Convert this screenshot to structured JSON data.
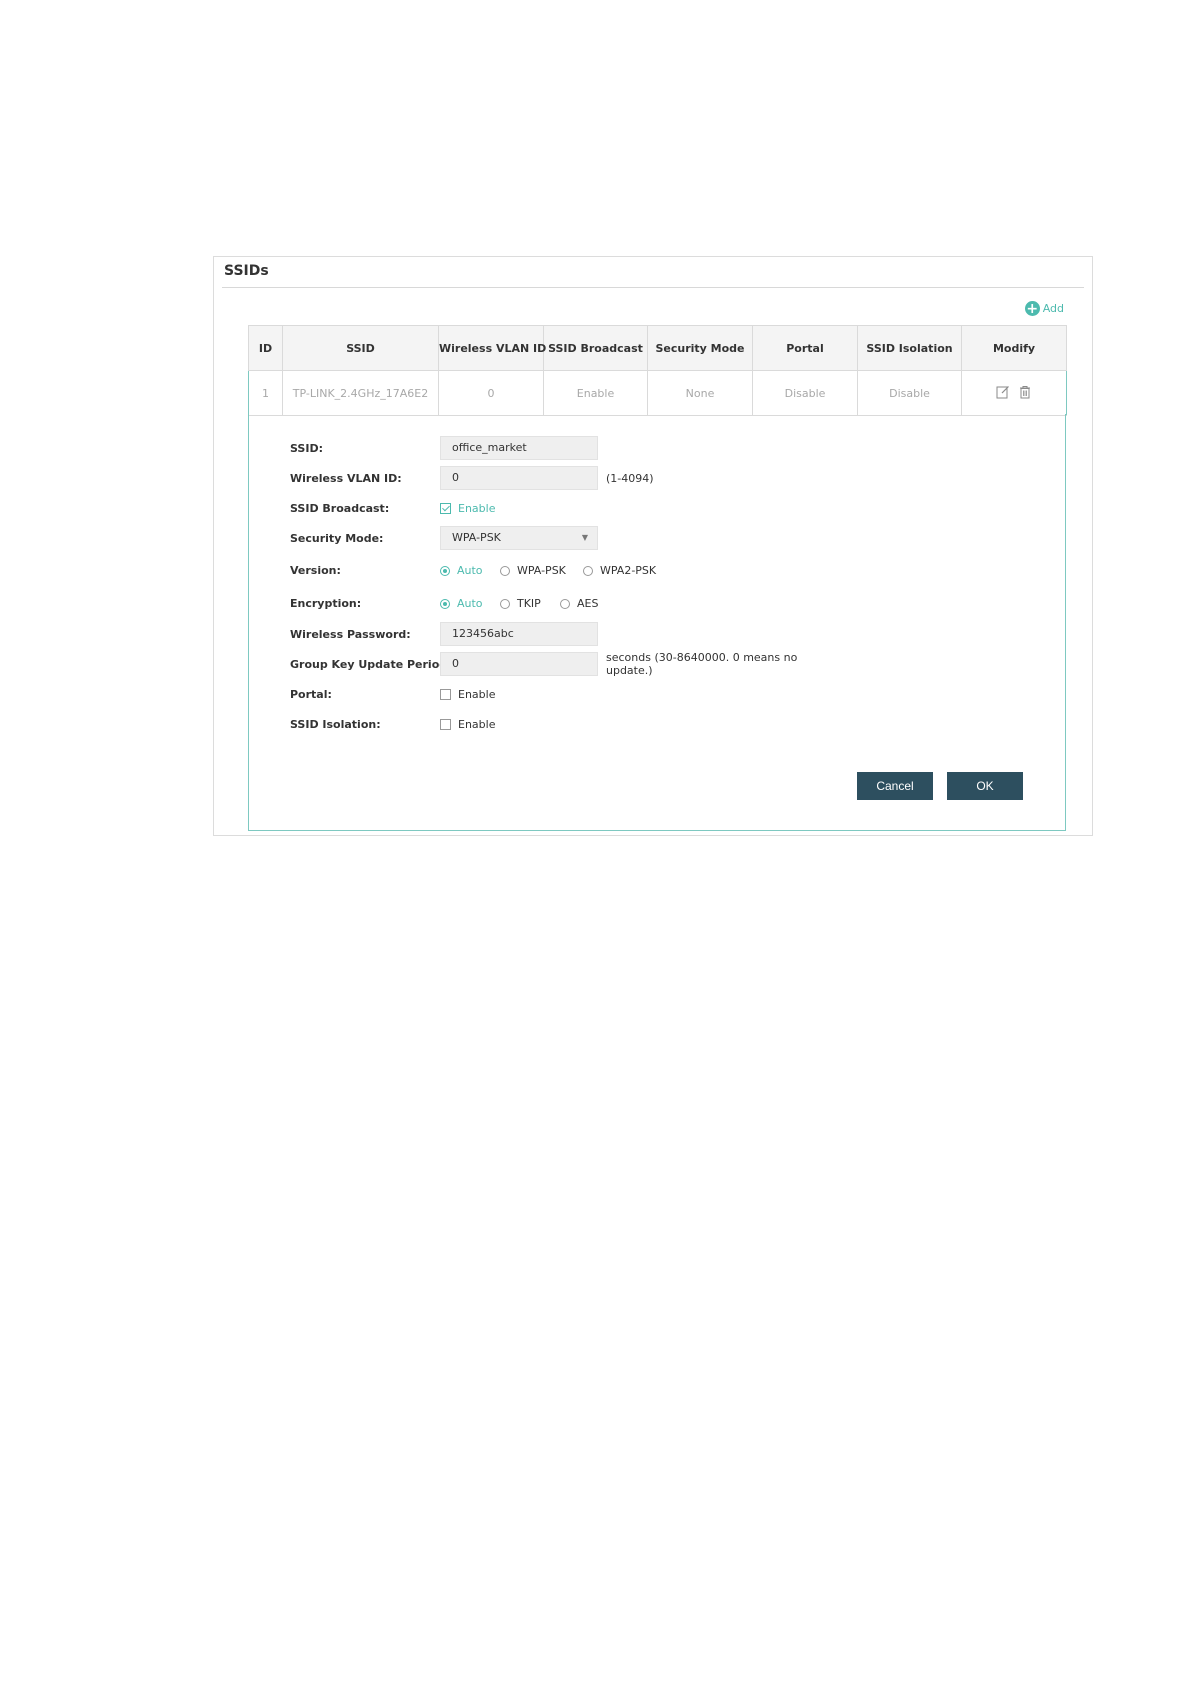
{
  "panel": {
    "title": "SSIDs",
    "add_label": "Add"
  },
  "table": {
    "headers": [
      "ID",
      "SSID",
      "Wireless VLAN ID",
      "SSID Broadcast",
      "Security Mode",
      "Portal",
      "SSID Isolation",
      "Modify"
    ],
    "rows": [
      {
        "id": "1",
        "ssid": "TP-LINK_2.4GHz_17A6E2",
        "vlan": "0",
        "broadcast": "Enable",
        "security": "None",
        "portal": "Disable",
        "isolation": "Disable"
      }
    ]
  },
  "form": {
    "ssid_label": "SSID:",
    "ssid_value": "office_market",
    "vlan_label": "Wireless VLAN ID:",
    "vlan_value": "0",
    "vlan_hint": "(1-4094)",
    "broadcast_label": "SSID Broadcast:",
    "broadcast_option": "Enable",
    "security_label": "Security Mode:",
    "security_value": "WPA-PSK",
    "version_label": "Version:",
    "version_options": [
      "Auto",
      "WPA-PSK",
      "WPA2-PSK"
    ],
    "encryption_label": "Encryption:",
    "encryption_options": [
      "Auto",
      "TKIP",
      "AES"
    ],
    "password_label": "Wireless Password:",
    "password_value": "123456abc",
    "group_key_label": "Group Key Update Period:",
    "group_key_value": "0",
    "group_key_hint_line1": "seconds (30-8640000. 0 means no",
    "group_key_hint_line2": "update.)",
    "portal_label": "Portal:",
    "portal_option": "Enable",
    "isolation_label": "SSID Isolation:",
    "isolation_option": "Enable"
  },
  "buttons": {
    "cancel": "Cancel",
    "ok": "OK"
  },
  "colors": {
    "accent": "#4cbaae",
    "button": "#2d4f5f"
  },
  "icons": {
    "add": "plus-circle-icon",
    "edit": "edit-icon",
    "delete": "trash-icon",
    "dropdown": "chevron-down-icon"
  }
}
